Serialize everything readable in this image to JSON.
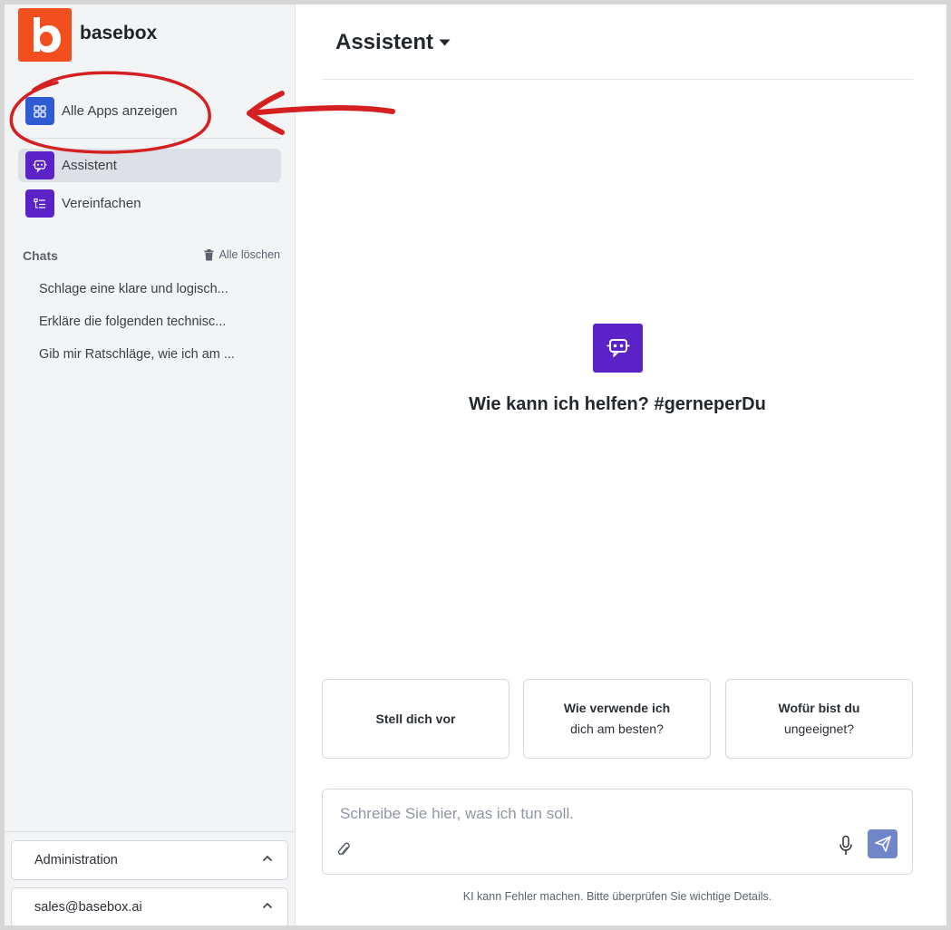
{
  "app": {
    "name": "basebox",
    "logo_letter": "b",
    "brand_color": "#f24e1e"
  },
  "sidebar": {
    "all_apps": {
      "label": "Alle Apps anzeigen",
      "icon": "grid-icon"
    },
    "apps": [
      {
        "label": "Assistent",
        "icon": "robot-icon",
        "active": true
      },
      {
        "label": "Vereinfachen",
        "icon": "list-simplify-icon",
        "active": false
      }
    ],
    "chats": {
      "title": "Chats",
      "clear_label": "Alle löschen",
      "items": [
        "Schlage eine klare und logisch...",
        "Erkläre die folgenden technisc...",
        "Gib mir Ratschläge, wie ich am ..."
      ]
    },
    "footer": {
      "administration": "Administration",
      "account": "sales@basebox.ai"
    }
  },
  "main": {
    "title": "Assistent",
    "greeting": "Wie kann ich helfen? #gerneperDu",
    "suggestions": [
      {
        "line1": "Stell dich vor",
        "line2": ""
      },
      {
        "line1": "Wie verwende ich",
        "line2": "dich am besten?"
      },
      {
        "line1": "Wofür bist du",
        "line2": "ungeeignet?"
      }
    ],
    "composer": {
      "placeholder": "Schreibe Sie hier, was ich tun soll.",
      "value": ""
    },
    "disclaimer": "KI kann Fehler machen. Bitte überprüfen Sie wichtige Details."
  },
  "colors": {
    "accent_purple": "#5b22c8",
    "accent_blue": "#2f5bd3",
    "send_button": "#6f87c9",
    "annotation_red": "#d42020"
  }
}
